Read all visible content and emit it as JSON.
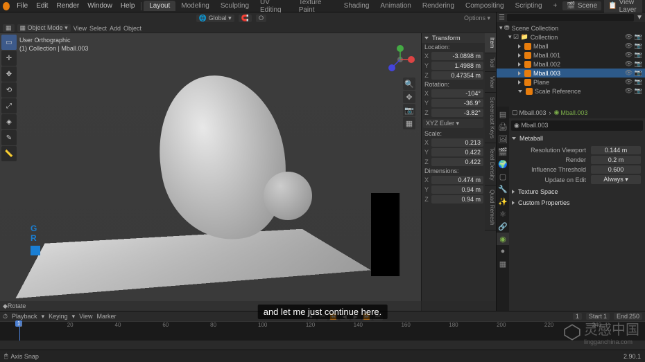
{
  "menu": {
    "file": "File",
    "edit": "Edit",
    "render": "Render",
    "window": "Window",
    "help": "Help"
  },
  "workspaces": [
    "Layout",
    "Modeling",
    "Sculpting",
    "UV Editing",
    "Texture Paint",
    "Shading",
    "Animation",
    "Rendering",
    "Compositing",
    "Scripting"
  ],
  "active_workspace": "Layout",
  "scene": {
    "label": "Scene",
    "view_layer": "View Layer"
  },
  "header": {
    "global": "Global",
    "options": "Options"
  },
  "view_header": {
    "mode": "Object Mode",
    "view": "View",
    "select": "Select",
    "add": "Add",
    "object": "Object"
  },
  "viewport_info": {
    "view": "User Orthographic",
    "path": "(1) Collection | Mball.003"
  },
  "axis_widget": {
    "g": "G",
    "r": "R"
  },
  "status_hint": "Rotate",
  "n_panel": {
    "tabs": [
      "Item",
      "Tool",
      "View",
      "Screencast Keys",
      "Texel Density",
      "Quad Remesh"
    ],
    "transform": "Transform",
    "location": "Location:",
    "loc": {
      "x": "-3.0898 m",
      "y": "1.4988 m",
      "z": "0.47354 m"
    },
    "rotation": "Rotation:",
    "rot": {
      "x": "-104°",
      "y": "-36.9°",
      "z": "-3.82°"
    },
    "rot_mode": "XYZ Euler",
    "scale": "Scale:",
    "sc": {
      "x": "0.213",
      "y": "0.422",
      "z": "0.422"
    },
    "dimensions": "Dimensions:",
    "dim": {
      "x": "0.474 m",
      "y": "0.94 m",
      "z": "0.94 m"
    }
  },
  "outliner": {
    "scene_coll": "Scene Collection",
    "coll": "Collection",
    "items": [
      "Mball",
      "Mball.001",
      "Mball.002",
      "Mball.003",
      "Plane",
      "Scale Reference"
    ],
    "selected": "Mball.003"
  },
  "properties": {
    "crumb1": "Mball.003",
    "crumb2": "Mball.003",
    "name": "Mball.003",
    "section_metaball": "Metaball",
    "res_viewport_l": "Resolution Viewport",
    "res_viewport_v": "0.144 m",
    "render_l": "Render",
    "render_v": "0.2 m",
    "influence_l": "Influence Threshold",
    "influence_v": "0.600",
    "update_l": "Update on Edit",
    "update_v": "Always",
    "texture_space": "Texture Space",
    "custom_props": "Custom Properties"
  },
  "timeline": {
    "playback": "Playback",
    "keying": "Keying",
    "view": "View",
    "marker": "Marker",
    "frame": "1",
    "start_l": "Start",
    "start_v": "1",
    "end_l": "End",
    "end_v": "250",
    "ticks": [
      "0",
      "20",
      "40",
      "60",
      "80",
      "100",
      "120",
      "140",
      "160",
      "180",
      "200",
      "220",
      "240"
    ]
  },
  "status": {
    "left": "Axis Snap",
    "version": "2.90.1"
  },
  "subtitle": "and let me just continue here.",
  "watermark": {
    "main": "灵感中国",
    "sub": "lingganchina.com"
  }
}
